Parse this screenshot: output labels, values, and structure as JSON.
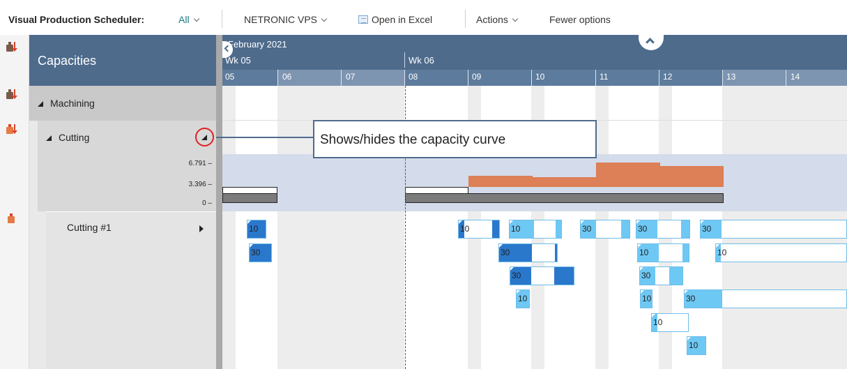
{
  "toolbar": {
    "title": "Visual Production Scheduler:",
    "filter_value": "All",
    "menu_netronic": "NETRONIC VPS",
    "open_excel": "Open in Excel",
    "actions": "Actions",
    "fewer_options": "Fewer options"
  },
  "left_panel": {
    "header": "Capacities",
    "rows": [
      {
        "label": "Machining"
      },
      {
        "label": "Cutting"
      },
      {
        "label": "Cutting #1"
      }
    ],
    "scale": {
      "max": "6.791 –",
      "mid": "3.396 –",
      "zero": "0 –"
    }
  },
  "timeline": {
    "month": "February 2021",
    "weeks": [
      "Wk 05",
      "Wk 06"
    ],
    "days": [
      "05",
      "06",
      "07",
      "08",
      "09",
      "10",
      "11",
      "12",
      "13",
      "14"
    ]
  },
  "operations": [
    "10",
    "10",
    "10",
    "10",
    "30",
    "30",
    "30",
    "30",
    "10",
    "10",
    "30",
    "30",
    "10",
    "10",
    "30",
    "30",
    "10"
  ],
  "callout": {
    "text": "Shows/hides the capacity curve"
  },
  "colors": {
    "header_blue": "#4e6b8c",
    "op_dark": "#2a78cc",
    "op_light": "#6ec8f4",
    "capacity_orange": "#dd7f57",
    "capacity_gray": "#7b7b7b",
    "highlight_red": "#e02020"
  },
  "icons": [
    "capacity-group-icon",
    "capacity-icon",
    "collapse-up-icon",
    "scroll-left-icon",
    "excel-icon"
  ]
}
